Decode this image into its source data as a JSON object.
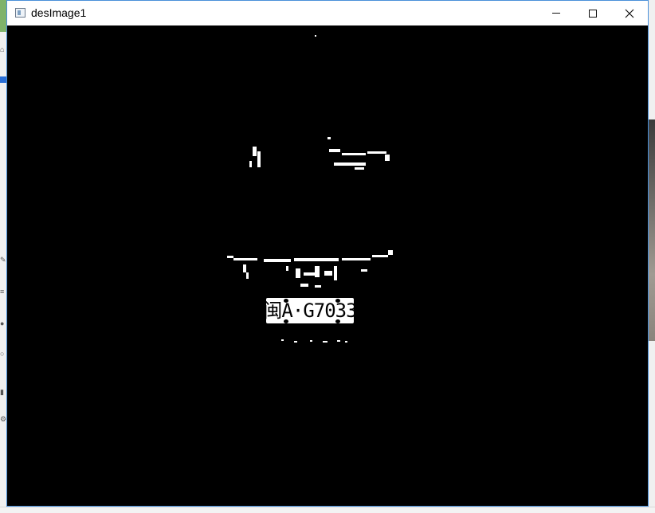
{
  "window": {
    "title": "desImage1",
    "controls": {
      "minimize": "minimize",
      "maximize": "maximize",
      "close": "close"
    }
  },
  "image": {
    "plate_text": "闽A·G7033",
    "background_color": "#000000",
    "foreground_color": "#ffffff"
  },
  "icons": {
    "app": "window-app-icon",
    "minimize": "minimize-icon",
    "maximize": "maximize-icon",
    "close": "close-icon"
  }
}
